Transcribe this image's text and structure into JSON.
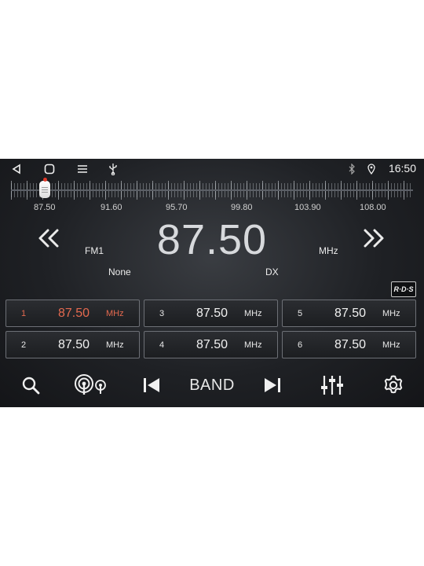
{
  "status_bar": {
    "time": "16:50",
    "icons": [
      "back-icon",
      "home-icon",
      "menu-icon",
      "usb-icon",
      "bluetooth-icon",
      "location-icon"
    ]
  },
  "tuner": {
    "scale_labels": [
      "87.50",
      "91.60",
      "95.70",
      "99.80",
      "103.90",
      "108.00"
    ],
    "frequency": "87.50",
    "band": "FM1",
    "unit": "MHz",
    "ps_name": "None",
    "mode": "DX",
    "rds_label": "R·D·S",
    "position_fraction": 0.0
  },
  "presets": [
    {
      "num": "1",
      "freq": "87.50",
      "unit": "MHz",
      "active": true
    },
    {
      "num": "2",
      "freq": "87.50",
      "unit": "MHz",
      "active": false
    },
    {
      "num": "3",
      "freq": "87.50",
      "unit": "MHz",
      "active": false
    },
    {
      "num": "4",
      "freq": "87.50",
      "unit": "MHz",
      "active": false
    },
    {
      "num": "5",
      "freq": "87.50",
      "unit": "MHz",
      "active": false
    },
    {
      "num": "6",
      "freq": "87.50",
      "unit": "MHz",
      "active": false
    }
  ],
  "toolbar": {
    "band_label": "BAND",
    "icons": [
      "search-icon",
      "broadcast-icon",
      "skip-previous-icon",
      "skip-next-icon",
      "equalizer-icon",
      "settings-icon"
    ]
  },
  "colors": {
    "active_preset": "#e4694f",
    "indicator": "#e33a2a"
  }
}
